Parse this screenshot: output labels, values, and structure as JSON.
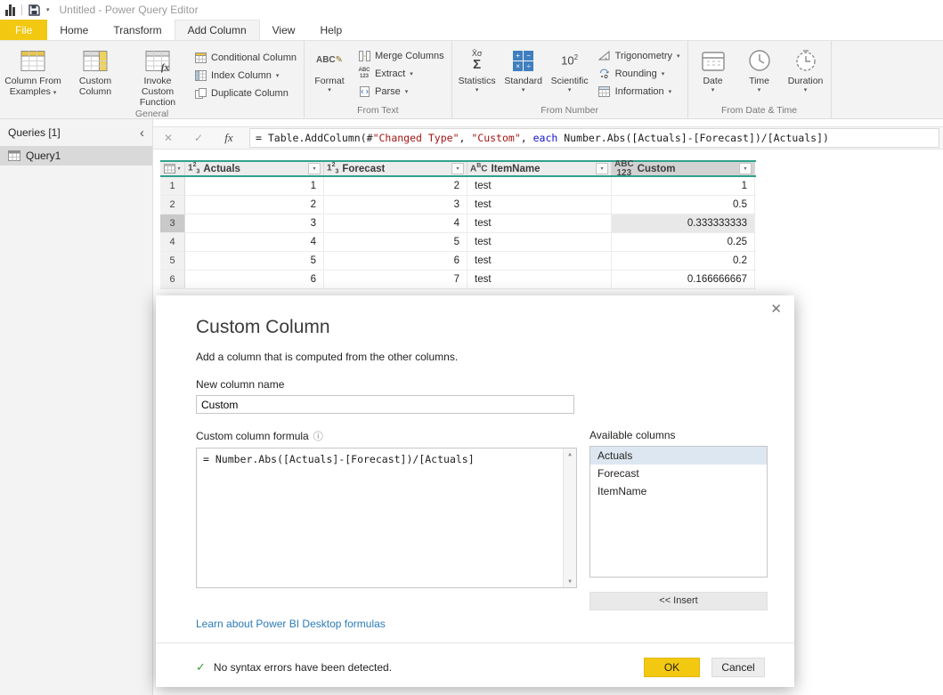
{
  "colors": {
    "accent": "#f2c811",
    "teal": "#2fa18c",
    "link": "#2b7bb9",
    "success": "#3f9c35",
    "string": "#a31515",
    "keyword": "#1414cc"
  },
  "titlebar": {
    "title": "Untitled - Power Query Editor"
  },
  "tabs": {
    "file": "File",
    "home": "Home",
    "transform": "Transform",
    "add_column": "Add Column",
    "view": "View",
    "help": "Help"
  },
  "ribbon": {
    "groups": {
      "general": "General",
      "from_text": "From Text",
      "from_number": "From Number",
      "from_date_time": "From Date & Time"
    },
    "buttons": {
      "column_from_examples": "Column From Examples",
      "custom_column": "Custom Column",
      "invoke_custom_function": "Invoke Custom Function",
      "conditional_column": "Conditional Column",
      "index_column": "Index Column",
      "duplicate_column": "Duplicate Column",
      "format": "Format",
      "merge_columns": "Merge Columns",
      "extract": "Extract",
      "parse": "Parse",
      "statistics": "Statistics",
      "standard": "Standard",
      "scientific": "Scientific",
      "trigonometry": "Trigonometry",
      "rounding": "Rounding",
      "information": "Information",
      "date": "Date",
      "time": "Time",
      "duration": "Duration"
    }
  },
  "sidebar": {
    "header": "Queries [1]",
    "items": [
      {
        "label": "Query1"
      }
    ]
  },
  "formula_bar": {
    "parts": [
      {
        "t": "= Table.AddColumn(#"
      },
      {
        "t": "\"Changed Type\""
      },
      {
        "t": ", "
      },
      {
        "t": "\"Custom\""
      },
      {
        "t": ", "
      },
      {
        "t": "each"
      },
      {
        "t": " Number.Abs([Actuals]-[Forecast])/[Actuals])"
      }
    ]
  },
  "grid": {
    "columns": [
      {
        "name": "Actuals",
        "type": "number"
      },
      {
        "name": "Forecast",
        "type": "number"
      },
      {
        "name": "ItemName",
        "type": "text"
      },
      {
        "name": "Custom",
        "type": "any",
        "selected": true
      }
    ],
    "rows": [
      {
        "n": "1",
        "cells": [
          "1",
          "2",
          "test",
          "1"
        ]
      },
      {
        "n": "2",
        "cells": [
          "2",
          "3",
          "test",
          "0.5"
        ]
      },
      {
        "n": "3",
        "cells": [
          "3",
          "4",
          "test",
          "0.333333333"
        ],
        "selected": true
      },
      {
        "n": "4",
        "cells": [
          "4",
          "5",
          "test",
          "0.25"
        ]
      },
      {
        "n": "5",
        "cells": [
          "5",
          "6",
          "test",
          "0.2"
        ]
      },
      {
        "n": "6",
        "cells": [
          "6",
          "7",
          "test",
          "0.166666667"
        ]
      }
    ]
  },
  "dialog": {
    "title": "Custom Column",
    "subtitle": "Add a column that is computed from the other columns.",
    "name_label": "New column name",
    "name_value": "Custom",
    "formula_label": "Custom column formula",
    "formula_value": "= Number.Abs([Actuals]-[Forecast])/[Actuals]",
    "available_label": "Available columns",
    "available_columns": [
      {
        "label": "Actuals",
        "selected": true
      },
      {
        "label": "Forecast"
      },
      {
        "label": "ItemName"
      }
    ],
    "insert_label": "<< Insert",
    "learn_link": "Learn about Power BI Desktop formulas",
    "status": "No syntax errors have been detected.",
    "ok_label": "OK",
    "cancel_label": "Cancel"
  },
  "icons": {
    "caret": "▾",
    "close": "✕",
    "check": "✓",
    "fx": "fx",
    "collapse": "‹",
    "info": "ⓘ",
    "up": "▲",
    "down": "▼",
    "one": "1",
    "two": "2",
    "three": "3",
    "a": "A",
    "b": "B",
    "c": "C",
    "abc": "ABC",
    "num123": "123",
    "stat_top": "X̄σ",
    "sigma": "Σ",
    "ten": "10",
    "exp2": "2",
    "plus": "+",
    "minus": "−",
    "times": "×",
    "divide": "÷",
    "pencil": "✎"
  }
}
